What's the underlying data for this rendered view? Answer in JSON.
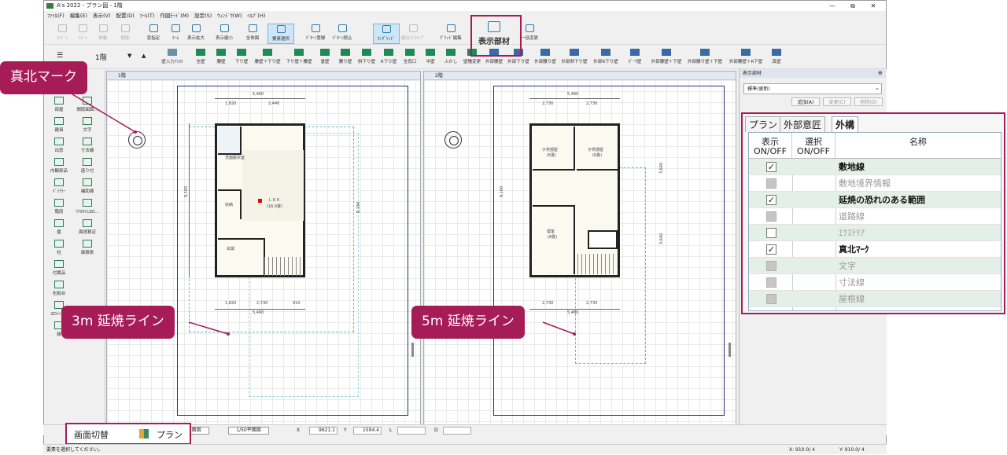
{
  "app": {
    "title": "A's 2022 - プラン図 - 1階",
    "window_controls": [
      "—",
      "⧉",
      "✕"
    ]
  },
  "menu": [
    "ﾌｧｲﾙ(F)",
    "編集(E)",
    "表示(V)",
    "配置(D)",
    "ﾂｰﾙ(T)",
    "作図ﾓｰﾄﾞ(M)",
    "設定(S)",
    "ｳｨﾝﾄﾞｳ(W)",
    "ﾍﾙﾌﾟ(H)"
  ],
  "toolbar1": [
    {
      "label": "ｱﾝﾄﾞｩ",
      "disabled": true
    },
    {
      "label": "ﾘﾄﾞｩ",
      "disabled": true
    },
    {
      "label": "移動",
      "disabled": true
    },
    {
      "label": "削除",
      "disabled": true
    },
    {
      "label": "窓指定",
      "disabled": false
    },
    {
      "label": "ｽｰﾑ",
      "disabled": false
    },
    {
      "label": "表示拡大",
      "disabled": false
    },
    {
      "label": "表示縮小",
      "disabled": false
    },
    {
      "label": "全体図",
      "disabled": false
    },
    {
      "label": "要素選択",
      "disabled": false,
      "selected": true
    },
    {
      "label": "ﾊﾟﾀｰﾝ登録",
      "disabled": false
    },
    {
      "label": "ﾊﾟﾀｰﾝ読込",
      "disabled": false
    },
    {
      "label": "ｵﾝｸﾞﾘｯﾄﾞ",
      "disabled": false,
      "selected": true
    },
    {
      "label": "縦分にｽﾅｯﾌﾟ",
      "disabled": true
    },
    {
      "label": "ｸﾞﾘｯﾄﾞ編集",
      "disabled": false
    },
    {
      "label": "表示部材",
      "disabled": false,
      "big": true
    },
    {
      "label": "一括変更",
      "disabled": false
    }
  ],
  "floor": {
    "label": "1階",
    "arrow_down": "▼",
    "arrow_up": "▲",
    "menu_icon": "☰"
  },
  "toolbar2": [
    "壁入力ｱｼｽﾄ",
    "全壁",
    "腰壁",
    "下り壁",
    "腰壁＋下り壁",
    "下り壁＋腰壁",
    "垂壁",
    "腰り壁",
    "斜下り壁",
    "R下り壁",
    "全窓口",
    "半壁",
    "ふかし",
    "壁種変更",
    "外部腰壁",
    "外部下り壁",
    "外部腰り壁",
    "外部斜下り壁",
    "外部R下り壁",
    "ﾎﾟｰﾁ壁",
    "外部腰壁＋下壁",
    "外部腰り壁＋下壁",
    "外部腰壁＋R下壁",
    "真壁"
  ],
  "left_palette": [
    {
      "a": "部屋",
      "b": "間取図面..."
    },
    {
      "a": "建具",
      "b": "文字"
    },
    {
      "a": "出窓",
      "b": "寸法線"
    },
    {
      "a": "内観部品",
      "b": "造り付"
    },
    {
      "a": "ﾊﾟﾗｱﾗｰ",
      "b": "補助線"
    },
    {
      "a": "階段",
      "b": "ﾘｱﾙﾀｲﾑ3D..."
    },
    {
      "a": "畳",
      "b": "面積算定"
    },
    {
      "a": "柱",
      "b": "面積表"
    },
    {
      "a": "付属品",
      "b": ""
    },
    {
      "a": "化粧台",
      "b": ""
    },
    {
      "a": "2Dｼﾝﾎﾞﾙ",
      "b": ""
    },
    {
      "a": "線",
      "b": ""
    }
  ],
  "pane_left": {
    "title": "1階",
    "dims_top": [
      "5,460",
      "1,820",
      "2,440"
    ],
    "dims_bottom": [
      "1,820",
      "2,730",
      "910",
      "5,460"
    ],
    "dims_side": [
      "9,100",
      "8,190",
      "1,820",
      "1,365",
      "1,820"
    ],
    "rooms": [
      "洗面脱衣室",
      "浴室",
      "ＬＤＫ",
      "(16.0畳)",
      "収納",
      "ﾎｰﾙ",
      "玄関",
      "ｸﾛｰｾﾞｯﾄ"
    ]
  },
  "pane_right": {
    "title": "2階",
    "dims_top": [
      "5,460",
      "2,730",
      "2,730"
    ],
    "dims_bottom": [
      "2,730",
      "2,730",
      "5,460"
    ],
    "dims_side": [
      "9,100",
      "3,640",
      "3,640"
    ],
    "rooms": [
      "子供部屋",
      "(6畳)",
      "子供部屋",
      "(6畳)",
      "寝室",
      "(8畳)",
      "ｸﾛｰｾﾞｯﾄ",
      "ｸﾛｰｾﾞｯﾄ",
      "ﾎｰﾙ"
    ]
  },
  "right_panel": {
    "header": "表示部材",
    "pin": "⊕",
    "dropdown": "標準(更新)",
    "buttons": [
      "追加(A)",
      "変更(C)",
      "削除(D)"
    ]
  },
  "display_panel": {
    "tabs": [
      "プラン",
      "外部意匠",
      "外構"
    ],
    "active_tab": 2,
    "headers": {
      "show": "表示\nON/OFF",
      "select": "選択\nON/OFF",
      "name": "名称"
    },
    "rows": [
      {
        "name": "敷地線",
        "state": "checked",
        "style": "bold"
      },
      {
        "name": "敷地境界情報",
        "state": "gray",
        "style": "dim"
      },
      {
        "name": "延焼の恐れのある範囲",
        "state": "checked",
        "style": "bold"
      },
      {
        "name": "道路線",
        "state": "gray",
        "style": "dim"
      },
      {
        "name": "ｴｸｽﾃﾘｱ",
        "state": "empty",
        "style": "dim"
      },
      {
        "name": "真北ﾏｰｸ",
        "state": "checked",
        "style": "bold"
      },
      {
        "name": "文字",
        "state": "gray",
        "style": "dim"
      },
      {
        "name": "寸法線",
        "state": "gray",
        "style": "dim"
      },
      {
        "name": "屋根線",
        "state": "gray",
        "style": "dim"
      }
    ]
  },
  "bottom_bar": {
    "screen_switch": "画面切替",
    "plan": "プラン",
    "scale1": "1/100平面図",
    "scale2": "1/50平面図",
    "x_label": "X",
    "x_value": "9621.1",
    "y_label": "Y",
    "y_value": "1594.4",
    "l_label": "L",
    "d_label": "D"
  },
  "status": {
    "message": "要素を選択してください。",
    "x": "X: 910.0/ 4",
    "y": "Y: 910.0/ 4"
  },
  "callouts": {
    "north": "真北マーク",
    "fire3": "3m 延焼ライン",
    "fire5": "5m 延焼ライン"
  }
}
